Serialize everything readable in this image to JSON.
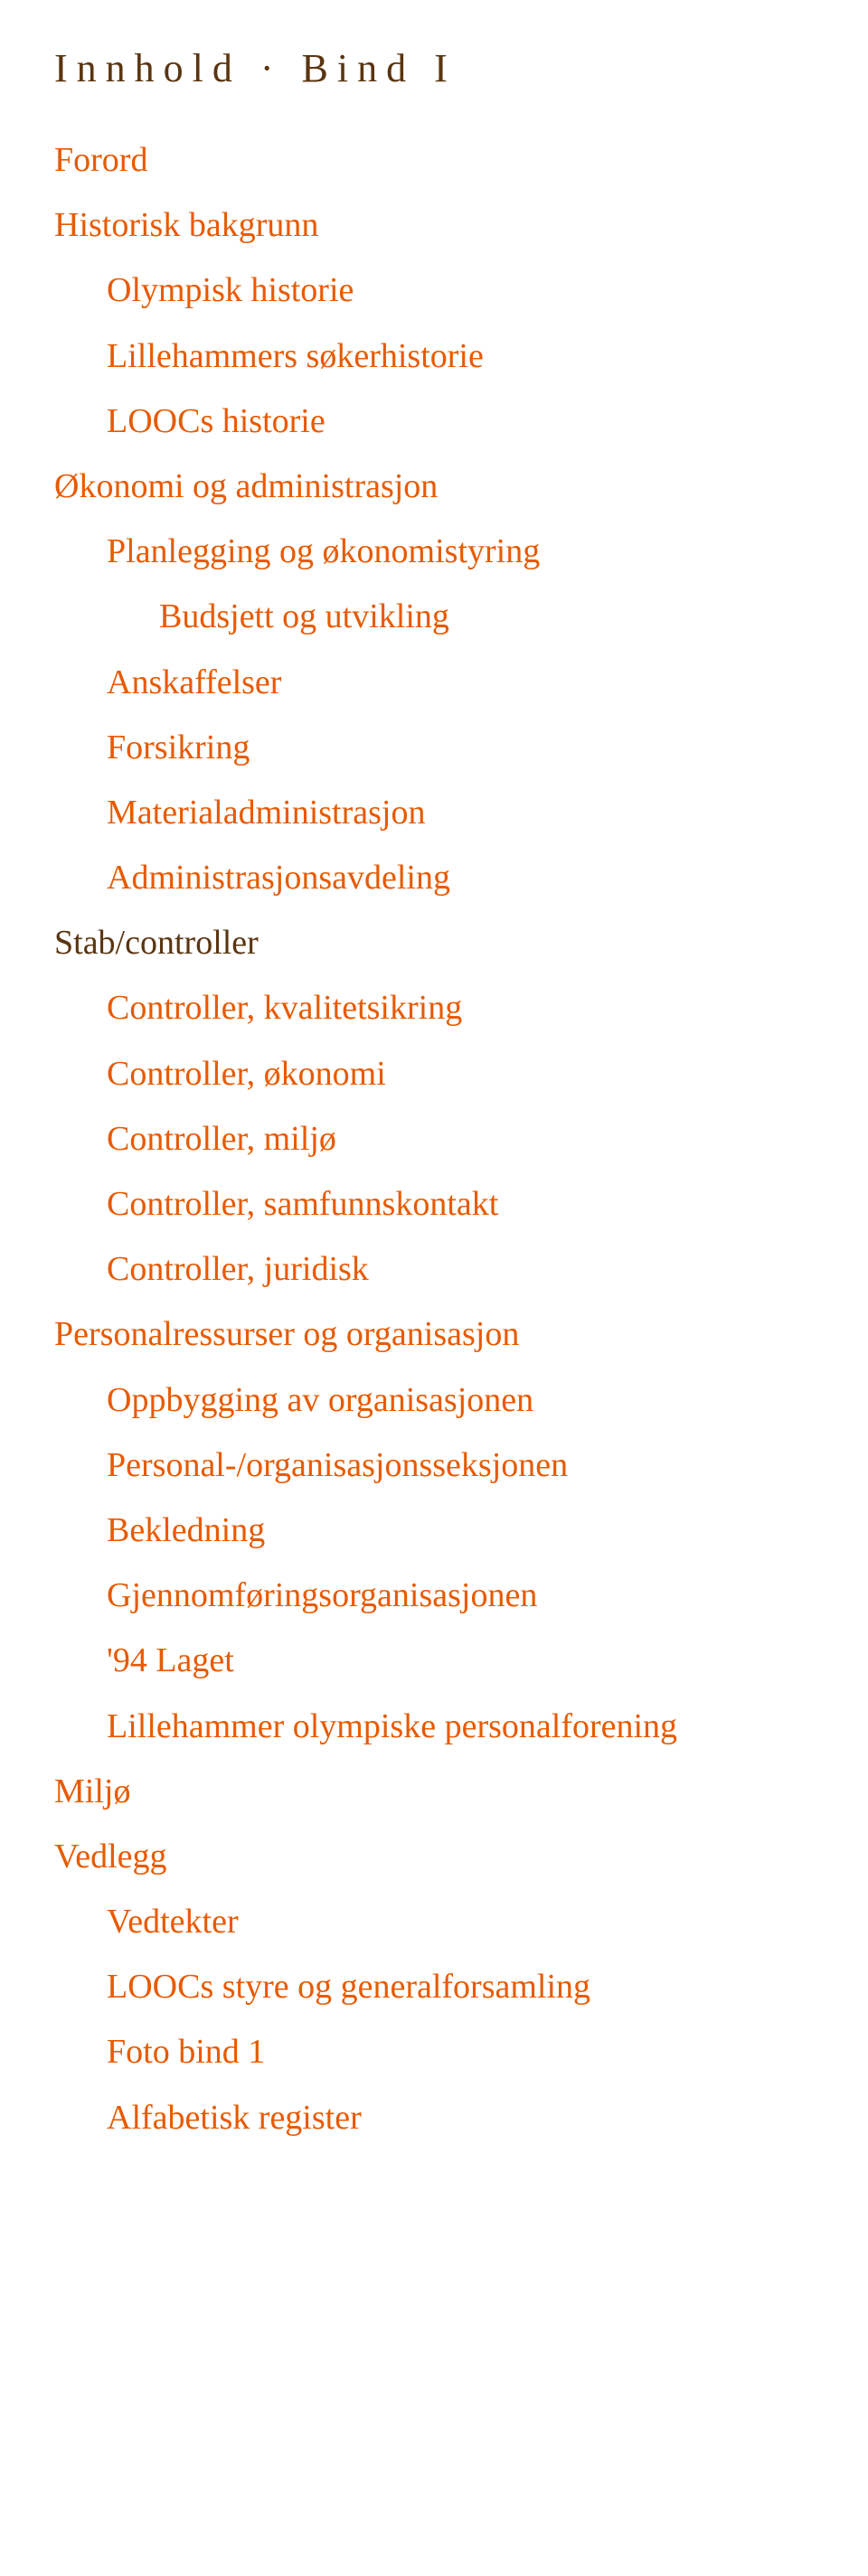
{
  "title": "Innhold · Bind I",
  "entries": [
    {
      "label": "Forord",
      "level": 0,
      "interactable": true
    },
    {
      "label": "Historisk bakgrunn",
      "level": 0,
      "interactable": true
    },
    {
      "label": "Olympisk historie",
      "level": 1,
      "interactable": true
    },
    {
      "label": "Lillehammers søkerhistorie",
      "level": 1,
      "interactable": true
    },
    {
      "label": "LOOCs historie",
      "level": 1,
      "interactable": true
    },
    {
      "label": "Økonomi og administrasjon",
      "level": 0,
      "interactable": true
    },
    {
      "label": "Planlegging og økonomistyring",
      "level": 1,
      "interactable": true
    },
    {
      "label": "Budsjett og utvikling",
      "level": 2,
      "interactable": true
    },
    {
      "label": "Anskaffelser",
      "level": 1,
      "interactable": true
    },
    {
      "label": "Forsikring",
      "level": 1,
      "interactable": true
    },
    {
      "label": "Materialadministrasjon",
      "level": 1,
      "interactable": true
    },
    {
      "label": "Administrasjonsavdeling",
      "level": 1,
      "interactable": true
    },
    {
      "label": "Stab/controller",
      "level": 0,
      "brown": true,
      "interactable": false
    },
    {
      "label": "Controller, kvalitetsikring",
      "level": 1,
      "interactable": true
    },
    {
      "label": "Controller, økonomi",
      "level": 1,
      "interactable": true
    },
    {
      "label": "Controller, miljø",
      "level": 1,
      "interactable": true
    },
    {
      "label": "Controller, samfunnskontakt",
      "level": 1,
      "interactable": true
    },
    {
      "label": "Controller, juridisk",
      "level": 1,
      "interactable": true
    },
    {
      "label": "Personalressurser og organisasjon",
      "level": 0,
      "interactable": true
    },
    {
      "label": "Oppbygging av organisasjonen",
      "level": 1,
      "interactable": true
    },
    {
      "label": "Personal-/organisasjonsseksjonen",
      "level": 1,
      "interactable": true
    },
    {
      "label": "Bekledning",
      "level": 1,
      "interactable": true
    },
    {
      "label": "Gjennomføringsorganisasjonen",
      "level": 1,
      "interactable": true
    },
    {
      "label": "'94 Laget",
      "level": 1,
      "interactable": true
    },
    {
      "label": "Lillehammer olympiske personalforening",
      "level": 1,
      "interactable": true
    },
    {
      "label": "Miljø",
      "level": 0,
      "interactable": true
    },
    {
      "label": "Vedlegg",
      "level": 0,
      "interactable": true
    },
    {
      "label": "Vedtekter",
      "level": 1,
      "interactable": true
    },
    {
      "label": "LOOCs styre og generalforsamling",
      "level": 1,
      "interactable": true
    },
    {
      "label": "Foto bind 1",
      "level": 1,
      "interactable": true
    },
    {
      "label": "Alfabetisk register",
      "level": 1,
      "interactable": true
    }
  ]
}
